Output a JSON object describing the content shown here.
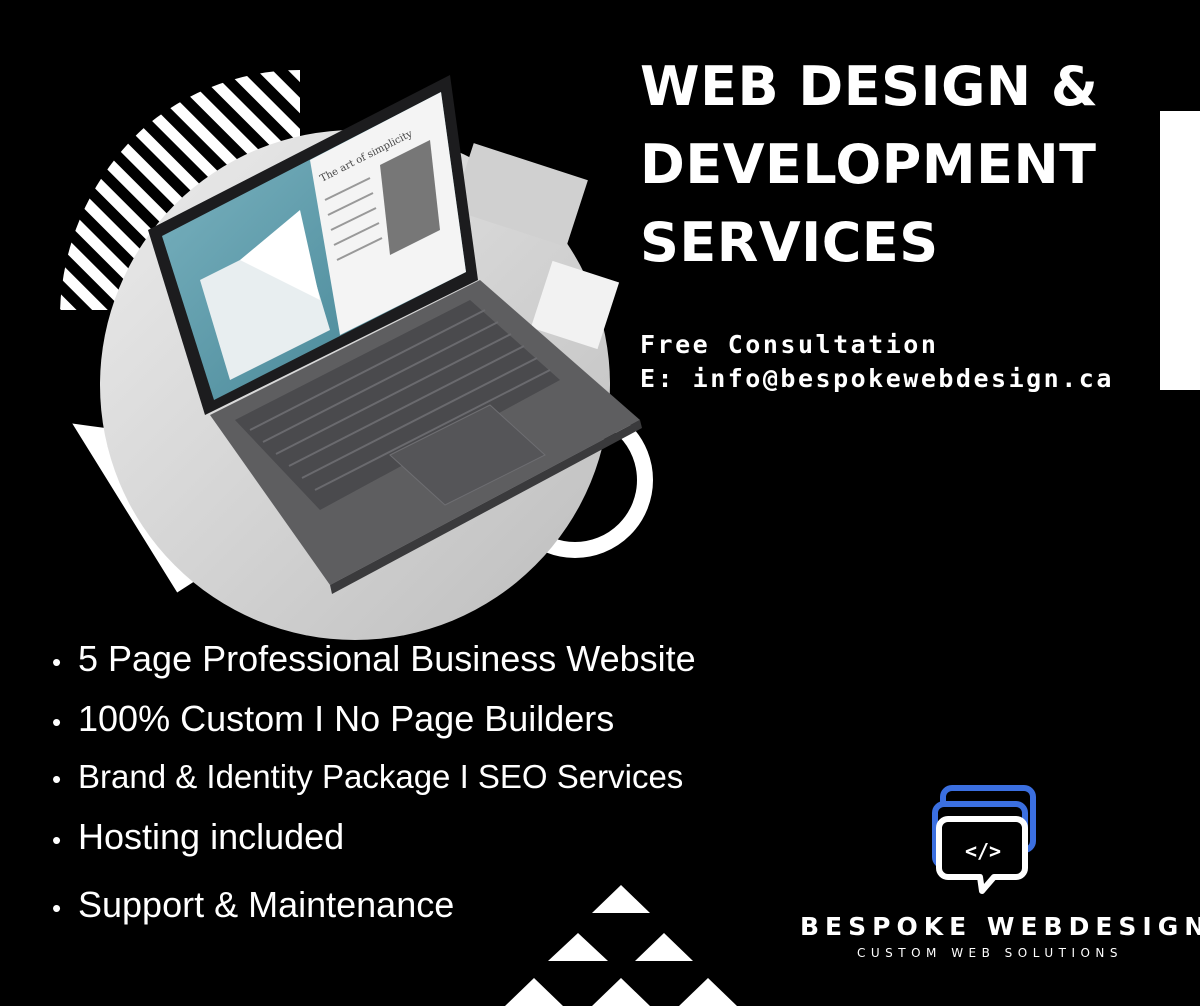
{
  "headline": {
    "line1": "WEB DESIGN &",
    "line2": "DEVELOPMENT",
    "line3": "SERVICES"
  },
  "contact": {
    "consultation": "Free Consultation",
    "email": "E: info@bespokewebdesign.ca"
  },
  "features": [
    {
      "bullet": "•",
      "text": "5 Page Professional Business Website"
    },
    {
      "bullet": "•",
      "text": "100% Custom I No Page Builders"
    },
    {
      "bullet": "•",
      "text": "Brand & Identity Package I  SEO Services"
    },
    {
      "bullet": "•",
      "text": "Hosting included"
    },
    {
      "bullet": "•",
      "text": "Support & Maintenance"
    }
  ],
  "laptop_screen": {
    "heading": "The art of simplicity"
  },
  "brand": {
    "name": "BESPOKE WEBDESIGN",
    "tagline": "CUSTOM WEB SOLUTIONS",
    "logo_icon": "code-chat-bubbles-icon",
    "logo_accent": "#3b6fe0"
  }
}
